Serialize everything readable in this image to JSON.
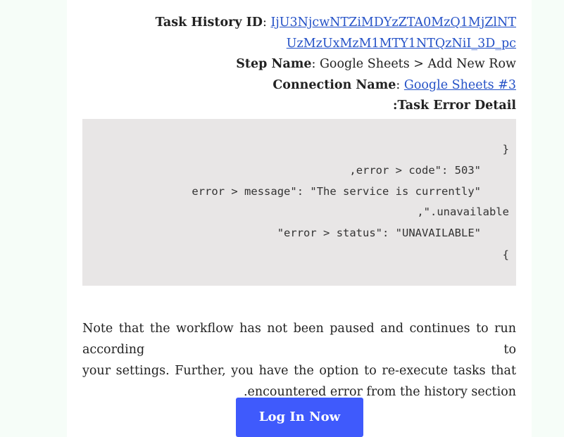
{
  "details": {
    "task_history_label": "Task History ID",
    "task_history_value_line1": "IjU3NjcwNTZiMDYzZTA0MzQ1MjZlNT",
    "task_history_value_line2": "UzMzUxMzM1MTY1NTQzNiI_3D_pc",
    "step_name_label": "Step Name",
    "step_name_value": "Google Sheets > Add New Row",
    "connection_label": "Connection Name",
    "connection_value": "Google Sheets #3",
    "error_detail_label": ":Task Error Detail",
    "separator": ": "
  },
  "error_block": {
    "lines": [
      "}",
      ",error > code\": 503\"",
      "error > message\": \"The service is currently\"",
      ",\".unavailable",
      "\"error > status\": \"UNAVAILABLE\"",
      "{"
    ]
  },
  "note": {
    "line1": "Note that the workflow has not been paused and continues to run according to",
    "line2": "your settings. Further, you have the option to re-execute tasks that",
    "line3": ".encountered error from the history section"
  },
  "cta": {
    "label": "Log In Now"
  }
}
